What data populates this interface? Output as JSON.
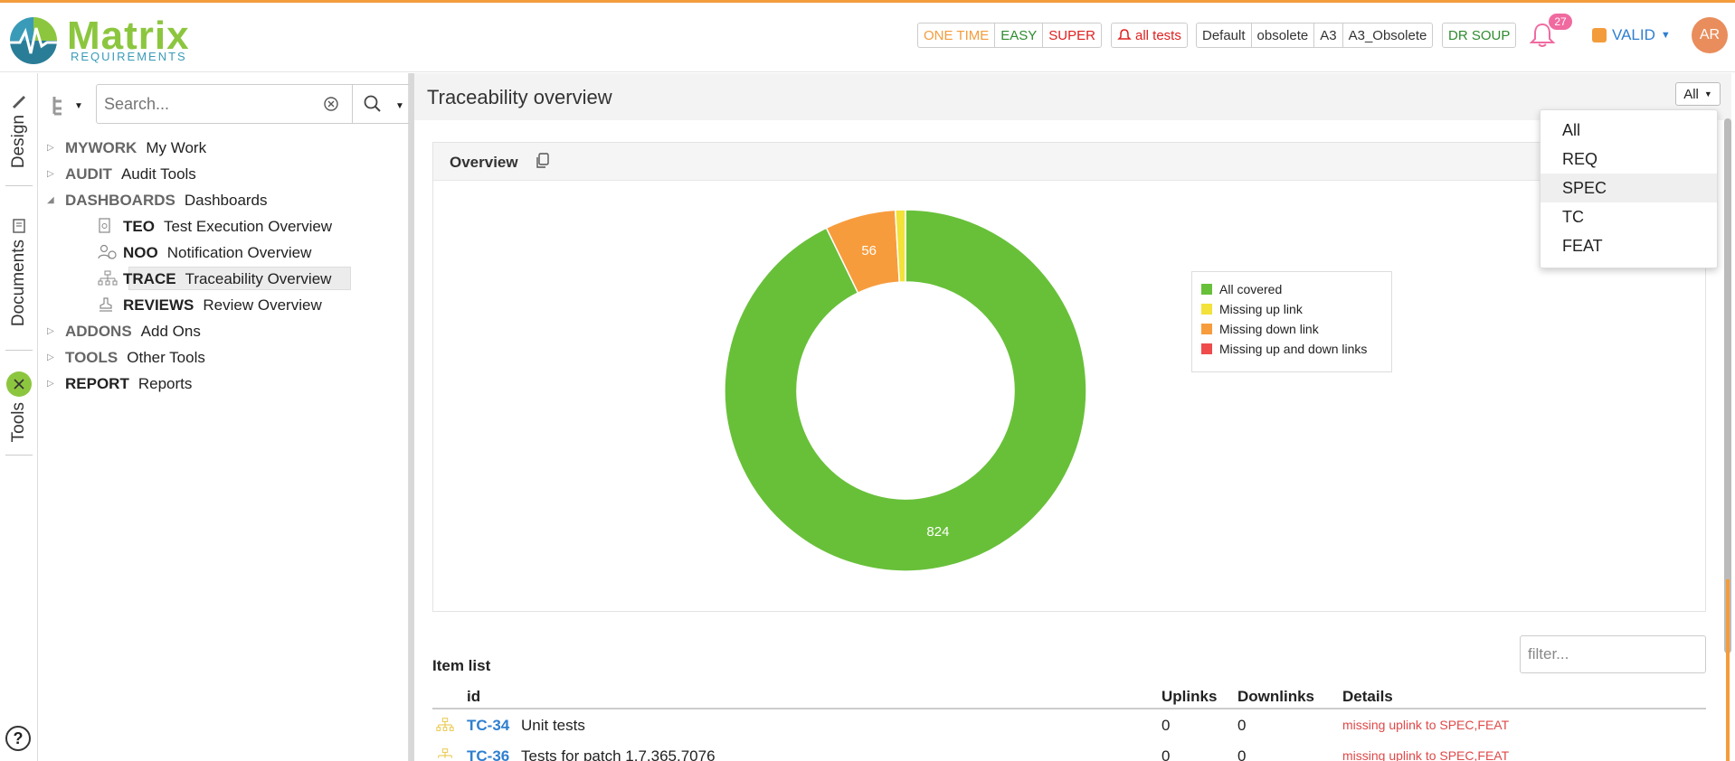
{
  "brand": {
    "name": "Matrix",
    "sub": "REQUIREMENTS"
  },
  "header": {
    "group1": [
      "ONE TIME",
      "EASY",
      "SUPER"
    ],
    "alltests": "all tests",
    "group3": [
      "Default",
      "obsolete",
      "A3",
      "A3_Obsolete"
    ],
    "drsoup": "DR SOUP",
    "notifications": "27",
    "status": "VALID",
    "avatar": "AR"
  },
  "rail": {
    "design": "Design",
    "documents": "Documents",
    "tools": "Tools",
    "help": "?"
  },
  "search": {
    "placeholder": "Search..."
  },
  "tree": [
    {
      "code": "MYWORK",
      "label": "My Work"
    },
    {
      "code": "AUDIT",
      "label": "Audit Tools"
    },
    {
      "code": "DASHBOARDS",
      "label": "Dashboards"
    },
    {
      "code": "TEO",
      "label": "Test Execution Overview"
    },
    {
      "code": "NOO",
      "label": "Notification Overview"
    },
    {
      "code": "TRACE",
      "label": "Traceability Overview"
    },
    {
      "code": "REVIEWS",
      "label": "Review Overview"
    },
    {
      "code": "ADDONS",
      "label": "Add Ons"
    },
    {
      "code": "TOOLS",
      "label": "Other Tools"
    },
    {
      "code": "REPORT",
      "label": "Reports"
    }
  ],
  "main": {
    "title": "Traceability overview",
    "filter_button": "All",
    "card_title": "Overview",
    "item_list_title": "Item list",
    "filter_placeholder": "filter..."
  },
  "dropdown": {
    "items": [
      "All",
      "REQ",
      "SPEC",
      "TC",
      "FEAT"
    ],
    "active": "SPEC"
  },
  "chart_data": {
    "type": "pie",
    "categories": [
      "All covered",
      "Missing up link",
      "Missing down link",
      "Missing up and down links"
    ],
    "values": [
      824,
      8,
      56,
      0
    ],
    "colors": [
      "#68c039",
      "#f2e23a",
      "#f79c3c",
      "#ef4b4b"
    ],
    "labels": [
      "824",
      "",
      "56",
      ""
    ],
    "legend_position": "top-right"
  },
  "table": {
    "headers": {
      "id": "id",
      "uplinks": "Uplinks",
      "downlinks": "Downlinks",
      "details": "Details"
    },
    "rows": [
      {
        "id": "TC-34",
        "title": "Unit tests",
        "uplinks": "0",
        "downlinks": "0",
        "details": "missing uplink to SPEC,FEAT"
      },
      {
        "id": "TC-36",
        "title": "Tests for patch 1.7.365.7076",
        "uplinks": "0",
        "downlinks": "0",
        "details": "missing uplink to SPEC,FEAT"
      }
    ]
  }
}
